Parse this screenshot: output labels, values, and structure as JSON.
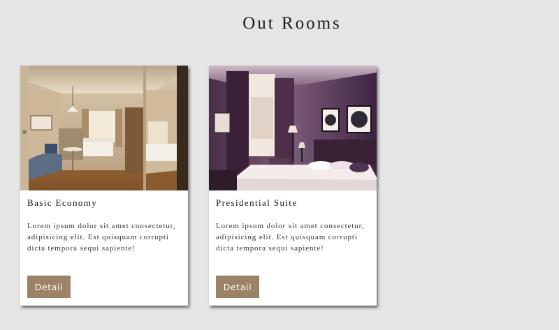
{
  "page": {
    "title": "Out Rooms"
  },
  "rooms": [
    {
      "name": "Basic Economy",
      "description": "Lorem ipsum dolor sit amet consectetur, adipisicing elit. Est quisquam corrupti dicta tempora sequi sapiente!",
      "button_label": "Detail"
    },
    {
      "name": "Presidential Suite",
      "description": "Lorem ipsum dolor sit amet consectetur, adipisicing elit. Est quisquam corrupti dicta tempora sequi sapiente!",
      "button_label": "Detail"
    }
  ],
  "colors": {
    "background": "#e5e5e5",
    "card": "#ffffff",
    "button": "#9c8266",
    "button_text": "#ffffff"
  }
}
